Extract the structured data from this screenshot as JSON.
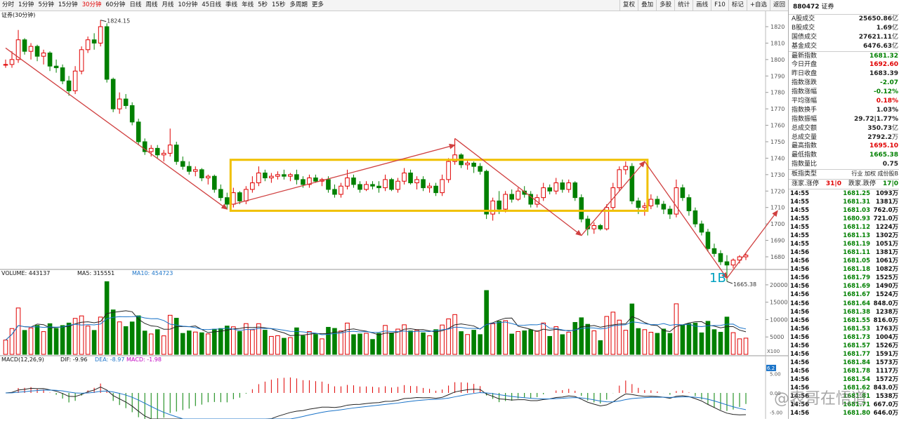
{
  "toolbar": {
    "periods": [
      "分时",
      "1分钟",
      "5分钟",
      "15分钟",
      "30分钟",
      "60分钟",
      "日线",
      "周线",
      "月线",
      "10分钟",
      "45日线",
      "季线",
      "年线",
      "5秒",
      "15秒",
      "多周期",
      "更多"
    ],
    "active_period": "30分钟",
    "buttons": [
      "复权",
      "叠加",
      "多股",
      "统计",
      "画线",
      "F10",
      "标记",
      "+自选",
      "返回"
    ]
  },
  "chart": {
    "title": "证券(30分钟)",
    "high_label": "1824.15",
    "low_label": "1665.38",
    "annotation": "1B",
    "price_axis": [
      "1820",
      "1810",
      "1800",
      "1790",
      "1780",
      "1770",
      "1760",
      "1750",
      "1740",
      "1730",
      "1720",
      "1710",
      "1700",
      "1690",
      "1680"
    ],
    "volume_header": {
      "name": "VOLUME",
      "vol": "VOLUME: 443137",
      "ma5": "MA5: 315551",
      "ma10": "MA10: 454723"
    },
    "volume_axis": [
      "20000",
      "15000",
      "10000",
      "5000"
    ],
    "volume_unit": "X100",
    "macd_header": {
      "name": "MACD(12,26,9)",
      "dif": "DIF: -9.96",
      "dea": "DEA: -8.97",
      "macd": "MACD: -1.98"
    },
    "macd_axis": [
      "6.2",
      "5.00",
      "0.00",
      "-5.00"
    ],
    "colors": {
      "up": "#e00000",
      "down": "#008000",
      "box": "#f0c000",
      "arrow": "#d04040"
    }
  },
  "chart_data": {
    "type": "candlestick",
    "title": "证券(30分钟)",
    "xlabel": "",
    "ylabel": "",
    "ylim": [
      1665,
      1825
    ],
    "candles": [
      {
        "o": 1797,
        "h": 1800,
        "l": 1795,
        "c": 1797
      },
      {
        "o": 1797,
        "h": 1805,
        "l": 1795,
        "c": 1800
      },
      {
        "o": 1800,
        "h": 1818,
        "l": 1798,
        "c": 1812
      },
      {
        "o": 1812,
        "h": 1813,
        "l": 1803,
        "c": 1805
      },
      {
        "o": 1805,
        "h": 1810,
        "l": 1800,
        "c": 1808
      },
      {
        "o": 1808,
        "h": 1809,
        "l": 1799,
        "c": 1802
      },
      {
        "o": 1802,
        "h": 1806,
        "l": 1797,
        "c": 1804
      },
      {
        "o": 1804,
        "h": 1805,
        "l": 1793,
        "c": 1796
      },
      {
        "o": 1796,
        "h": 1800,
        "l": 1792,
        "c": 1795
      },
      {
        "o": 1795,
        "h": 1797,
        "l": 1785,
        "c": 1787
      },
      {
        "o": 1787,
        "h": 1790,
        "l": 1778,
        "c": 1781
      },
      {
        "o": 1781,
        "h": 1796,
        "l": 1779,
        "c": 1793
      },
      {
        "o": 1793,
        "h": 1808,
        "l": 1791,
        "c": 1806
      },
      {
        "o": 1806,
        "h": 1814,
        "l": 1804,
        "c": 1812
      },
      {
        "o": 1812,
        "h": 1816,
        "l": 1806,
        "c": 1810
      },
      {
        "o": 1810,
        "h": 1824,
        "l": 1808,
        "c": 1820
      },
      {
        "o": 1820,
        "h": 1822,
        "l": 1786,
        "c": 1788
      },
      {
        "o": 1788,
        "h": 1789,
        "l": 1768,
        "c": 1770
      },
      {
        "o": 1770,
        "h": 1780,
        "l": 1767,
        "c": 1776
      },
      {
        "o": 1776,
        "h": 1779,
        "l": 1770,
        "c": 1772
      },
      {
        "o": 1772,
        "h": 1774,
        "l": 1760,
        "c": 1762
      },
      {
        "o": 1762,
        "h": 1764,
        "l": 1748,
        "c": 1750
      },
      {
        "o": 1750,
        "h": 1752,
        "l": 1742,
        "c": 1744
      },
      {
        "o": 1744,
        "h": 1748,
        "l": 1741,
        "c": 1746
      },
      {
        "o": 1746,
        "h": 1748,
        "l": 1740,
        "c": 1742
      },
      {
        "o": 1742,
        "h": 1745,
        "l": 1738,
        "c": 1743
      },
      {
        "o": 1743,
        "h": 1758,
        "l": 1741,
        "c": 1748
      },
      {
        "o": 1748,
        "h": 1750,
        "l": 1736,
        "c": 1738
      },
      {
        "o": 1738,
        "h": 1741,
        "l": 1733,
        "c": 1735
      },
      {
        "o": 1735,
        "h": 1738,
        "l": 1730,
        "c": 1732
      },
      {
        "o": 1732,
        "h": 1735,
        "l": 1729,
        "c": 1733
      },
      {
        "o": 1733,
        "h": 1734,
        "l": 1726,
        "c": 1728
      },
      {
        "o": 1728,
        "h": 1730,
        "l": 1724,
        "c": 1729
      },
      {
        "o": 1729,
        "h": 1730,
        "l": 1719,
        "c": 1721
      },
      {
        "o": 1721,
        "h": 1724,
        "l": 1714,
        "c": 1716
      },
      {
        "o": 1716,
        "h": 1719,
        "l": 1709,
        "c": 1712
      },
      {
        "o": 1712,
        "h": 1722,
        "l": 1710,
        "c": 1719
      },
      {
        "o": 1719,
        "h": 1720,
        "l": 1712,
        "c": 1714
      },
      {
        "o": 1714,
        "h": 1723,
        "l": 1712,
        "c": 1721
      },
      {
        "o": 1721,
        "h": 1729,
        "l": 1719,
        "c": 1725
      },
      {
        "o": 1725,
        "h": 1735,
        "l": 1723,
        "c": 1731
      },
      {
        "o": 1731,
        "h": 1733,
        "l": 1726,
        "c": 1728
      },
      {
        "o": 1728,
        "h": 1731,
        "l": 1725,
        "c": 1729
      },
      {
        "o": 1729,
        "h": 1732,
        "l": 1727,
        "c": 1730
      },
      {
        "o": 1730,
        "h": 1733,
        "l": 1727,
        "c": 1729
      },
      {
        "o": 1729,
        "h": 1731,
        "l": 1726,
        "c": 1730
      },
      {
        "o": 1730,
        "h": 1733,
        "l": 1724,
        "c": 1727
      },
      {
        "o": 1727,
        "h": 1729,
        "l": 1722,
        "c": 1724
      },
      {
        "o": 1724,
        "h": 1730,
        "l": 1722,
        "c": 1728
      },
      {
        "o": 1728,
        "h": 1730,
        "l": 1725,
        "c": 1726
      },
      {
        "o": 1726,
        "h": 1728,
        "l": 1723,
        "c": 1727
      },
      {
        "o": 1727,
        "h": 1729,
        "l": 1719,
        "c": 1721
      },
      {
        "o": 1721,
        "h": 1724,
        "l": 1716,
        "c": 1718
      },
      {
        "o": 1718,
        "h": 1725,
        "l": 1716,
        "c": 1723
      },
      {
        "o": 1723,
        "h": 1733,
        "l": 1721,
        "c": 1728
      },
      {
        "o": 1728,
        "h": 1730,
        "l": 1722,
        "c": 1724
      },
      {
        "o": 1724,
        "h": 1726,
        "l": 1719,
        "c": 1721
      },
      {
        "o": 1721,
        "h": 1726,
        "l": 1720,
        "c": 1724
      },
      {
        "o": 1724,
        "h": 1726,
        "l": 1721,
        "c": 1723
      },
      {
        "o": 1723,
        "h": 1726,
        "l": 1719,
        "c": 1722
      },
      {
        "o": 1722,
        "h": 1730,
        "l": 1720,
        "c": 1727
      },
      {
        "o": 1727,
        "h": 1728,
        "l": 1720,
        "c": 1721
      },
      {
        "o": 1721,
        "h": 1728,
        "l": 1719,
        "c": 1726
      },
      {
        "o": 1726,
        "h": 1734,
        "l": 1724,
        "c": 1731
      },
      {
        "o": 1731,
        "h": 1733,
        "l": 1724,
        "c": 1725
      },
      {
        "o": 1725,
        "h": 1729,
        "l": 1721,
        "c": 1727
      },
      {
        "o": 1727,
        "h": 1729,
        "l": 1720,
        "c": 1722
      },
      {
        "o": 1722,
        "h": 1725,
        "l": 1719,
        "c": 1723
      },
      {
        "o": 1723,
        "h": 1725,
        "l": 1717,
        "c": 1719
      },
      {
        "o": 1719,
        "h": 1730,
        "l": 1717,
        "c": 1727
      },
      {
        "o": 1727,
        "h": 1740,
        "l": 1725,
        "c": 1738
      },
      {
        "o": 1738,
        "h": 1752,
        "l": 1736,
        "c": 1742
      },
      {
        "o": 1742,
        "h": 1743,
        "l": 1734,
        "c": 1736
      },
      {
        "o": 1736,
        "h": 1739,
        "l": 1733,
        "c": 1737
      },
      {
        "o": 1737,
        "h": 1738,
        "l": 1731,
        "c": 1735
      },
      {
        "o": 1735,
        "h": 1737,
        "l": 1730,
        "c": 1732
      },
      {
        "o": 1732,
        "h": 1733,
        "l": 1703,
        "c": 1706
      },
      {
        "o": 1706,
        "h": 1716,
        "l": 1702,
        "c": 1714
      },
      {
        "o": 1714,
        "h": 1720,
        "l": 1706,
        "c": 1709
      },
      {
        "o": 1709,
        "h": 1720,
        "l": 1707,
        "c": 1718
      },
      {
        "o": 1718,
        "h": 1721,
        "l": 1713,
        "c": 1715
      },
      {
        "o": 1715,
        "h": 1722,
        "l": 1714,
        "c": 1720
      },
      {
        "o": 1720,
        "h": 1723,
        "l": 1716,
        "c": 1718
      },
      {
        "o": 1718,
        "h": 1720,
        "l": 1710,
        "c": 1712
      },
      {
        "o": 1712,
        "h": 1718,
        "l": 1710,
        "c": 1716
      },
      {
        "o": 1716,
        "h": 1725,
        "l": 1714,
        "c": 1722
      },
      {
        "o": 1722,
        "h": 1724,
        "l": 1718,
        "c": 1720
      },
      {
        "o": 1720,
        "h": 1728,
        "l": 1718,
        "c": 1725
      },
      {
        "o": 1725,
        "h": 1727,
        "l": 1719,
        "c": 1721
      },
      {
        "o": 1721,
        "h": 1727,
        "l": 1719,
        "c": 1725
      },
      {
        "o": 1725,
        "h": 1726,
        "l": 1714,
        "c": 1716
      },
      {
        "o": 1716,
        "h": 1718,
        "l": 1701,
        "c": 1703
      },
      {
        "o": 1703,
        "h": 1705,
        "l": 1693,
        "c": 1697
      },
      {
        "o": 1697,
        "h": 1701,
        "l": 1694,
        "c": 1699
      },
      {
        "o": 1699,
        "h": 1700,
        "l": 1696,
        "c": 1697
      },
      {
        "o": 1697,
        "h": 1712,
        "l": 1696,
        "c": 1710
      },
      {
        "o": 1710,
        "h": 1725,
        "l": 1708,
        "c": 1722
      },
      {
        "o": 1722,
        "h": 1735,
        "l": 1720,
        "c": 1733
      },
      {
        "o": 1733,
        "h": 1738,
        "l": 1730,
        "c": 1735
      },
      {
        "o": 1735,
        "h": 1737,
        "l": 1712,
        "c": 1714
      },
      {
        "o": 1714,
        "h": 1716,
        "l": 1706,
        "c": 1710
      },
      {
        "o": 1710,
        "h": 1713,
        "l": 1705,
        "c": 1711
      },
      {
        "o": 1711,
        "h": 1718,
        "l": 1709,
        "c": 1715
      },
      {
        "o": 1715,
        "h": 1717,
        "l": 1710,
        "c": 1712
      },
      {
        "o": 1712,
        "h": 1714,
        "l": 1706,
        "c": 1709
      },
      {
        "o": 1709,
        "h": 1711,
        "l": 1703,
        "c": 1706
      },
      {
        "o": 1706,
        "h": 1727,
        "l": 1704,
        "c": 1722
      },
      {
        "o": 1722,
        "h": 1724,
        "l": 1714,
        "c": 1716
      },
      {
        "o": 1716,
        "h": 1718,
        "l": 1705,
        "c": 1708
      },
      {
        "o": 1708,
        "h": 1710,
        "l": 1698,
        "c": 1700
      },
      {
        "o": 1700,
        "h": 1702,
        "l": 1693,
        "c": 1695
      },
      {
        "o": 1695,
        "h": 1697,
        "l": 1683,
        "c": 1685
      },
      {
        "o": 1685,
        "h": 1688,
        "l": 1680,
        "c": 1682
      },
      {
        "o": 1682,
        "h": 1684,
        "l": 1675,
        "c": 1677
      },
      {
        "o": 1677,
        "h": 1681,
        "l": 1665,
        "c": 1675
      },
      {
        "o": 1675,
        "h": 1679,
        "l": 1673,
        "c": 1678
      },
      {
        "o": 1678,
        "h": 1681,
        "l": 1676,
        "c": 1680
      },
      {
        "o": 1680,
        "h": 1682,
        "l": 1678,
        "c": 1681
      }
    ],
    "box": {
      "x_start": 36,
      "x_end": 101,
      "y_low": 1708,
      "y_high": 1739
    },
    "arrows": [
      {
        "from": [
          0,
          1807
        ],
        "to": [
          35,
          1709
        ]
      },
      {
        "from": [
          36,
          1712
        ],
        "to": [
          71,
          1748
        ]
      },
      {
        "from": [
          71,
          1752
        ],
        "to": [
          91,
          1693
        ]
      },
      {
        "from": [
          91,
          1693
        ],
        "to": [
          101,
          1738
        ]
      },
      {
        "from": [
          101,
          1738
        ],
        "to": [
          114,
          1667
        ]
      },
      {
        "from": [
          114,
          1667
        ],
        "to": [
          122,
          1708
        ]
      }
    ]
  },
  "right_panel": {
    "code": "880472",
    "name": "证券",
    "stats": [
      {
        "label": "A股成交",
        "value": "25650.86",
        "unit": "亿",
        "color": "normal"
      },
      {
        "label": "B股成交",
        "value": "1.69",
        "unit": "亿",
        "color": "normal"
      },
      {
        "label": "国债成交",
        "value": "27621.11",
        "unit": "亿",
        "color": "normal"
      },
      {
        "label": "基金成交",
        "value": "6476.63",
        "unit": "亿",
        "color": "normal"
      },
      {
        "label": "最新指数",
        "value": "1681.32",
        "unit": "",
        "color": "green",
        "sep": true
      },
      {
        "label": "今日开盘",
        "value": "1692.60",
        "unit": "",
        "color": "red"
      },
      {
        "label": "昨日收盘",
        "value": "1683.39",
        "unit": "",
        "color": "normal"
      },
      {
        "label": "指数涨跌",
        "value": "-2.07",
        "unit": "",
        "color": "green"
      },
      {
        "label": "指数涨幅",
        "value": "-0.12%",
        "unit": "",
        "color": "green"
      },
      {
        "label": "平均涨幅",
        "value": "0.18%",
        "unit": "",
        "color": "red"
      },
      {
        "label": "指数换手",
        "value": "1.03%",
        "unit": "",
        "color": "normal"
      },
      {
        "label": "指数振幅",
        "value": "29.72|1.77%",
        "unit": "",
        "color": "normal"
      },
      {
        "label": "总成交额",
        "value": "350.73",
        "unit": "亿",
        "color": "normal"
      },
      {
        "label": "总成交量",
        "value": "2792.2",
        "unit": "万",
        "color": "normal"
      },
      {
        "label": "最高指数",
        "value": "1695.10",
        "unit": "",
        "color": "red"
      },
      {
        "label": "最低指数",
        "value": "1665.38",
        "unit": "",
        "color": "green"
      },
      {
        "label": "指数量比",
        "value": "0.75",
        "unit": "",
        "color": "normal"
      }
    ],
    "board_type_label": "板指类型",
    "board_type_value": "行业 加权 成份股B",
    "updown_label": "涨家.涨停",
    "updown_value": "31|0",
    "down_label": "跌家.跌停",
    "down_value": "17|0",
    "ticks": [
      {
        "t": "14:55",
        "p": "1681.25",
        "q": "1093万"
      },
      {
        "t": "14:55",
        "p": "1681.31",
        "q": "1381万"
      },
      {
        "t": "14:55",
        "p": "1681.03",
        "q": "762.0万"
      },
      {
        "t": "14:55",
        "p": "1680.93",
        "q": "721.0万"
      },
      {
        "t": "14:55",
        "p": "1681.12",
        "q": "1224万"
      },
      {
        "t": "14:55",
        "p": "1681.13",
        "q": "1302万"
      },
      {
        "t": "14:55",
        "p": "1681.19",
        "q": "1051万"
      },
      {
        "t": "14:56",
        "p": "1681.11",
        "q": "1381万"
      },
      {
        "t": "14:56",
        "p": "1681.05",
        "q": "1061万"
      },
      {
        "t": "14:56",
        "p": "1681.18",
        "q": "1082万"
      },
      {
        "t": "14:56",
        "p": "1681.79",
        "q": "1525万"
      },
      {
        "t": "14:56",
        "p": "1681.69",
        "q": "1490万"
      },
      {
        "t": "14:56",
        "p": "1681.67",
        "q": "1524万"
      },
      {
        "t": "14:56",
        "p": "1681.64",
        "q": "848.0万"
      },
      {
        "t": "14:56",
        "p": "1681.38",
        "q": "1238万"
      },
      {
        "t": "14:56",
        "p": "1681.55",
        "q": "816.0万"
      },
      {
        "t": "14:56",
        "p": "1681.53",
        "q": "1763万"
      },
      {
        "t": "14:56",
        "p": "1681.73",
        "q": "1004万"
      },
      {
        "t": "14:56",
        "p": "1681.57",
        "q": "1526万"
      },
      {
        "t": "14:56",
        "p": "1681.77",
        "q": "1591万"
      },
      {
        "t": "14:56",
        "p": "1681.84",
        "q": "1573万"
      },
      {
        "t": "14:56",
        "p": "1681.78",
        "q": "1117万"
      },
      {
        "t": "14:56",
        "p": "1681.54",
        "q": "1572万"
      },
      {
        "t": "14:56",
        "p": "1681.62",
        "q": "843.0万"
      },
      {
        "t": "14:56",
        "p": "1681.81",
        "q": "1538万"
      },
      {
        "t": "14:56",
        "p": "1681.71",
        "q": "667.0万"
      },
      {
        "t": "14:56",
        "p": "1681.80",
        "q": "646.0万"
      }
    ]
  },
  "watermark": "@表哥在悟道"
}
